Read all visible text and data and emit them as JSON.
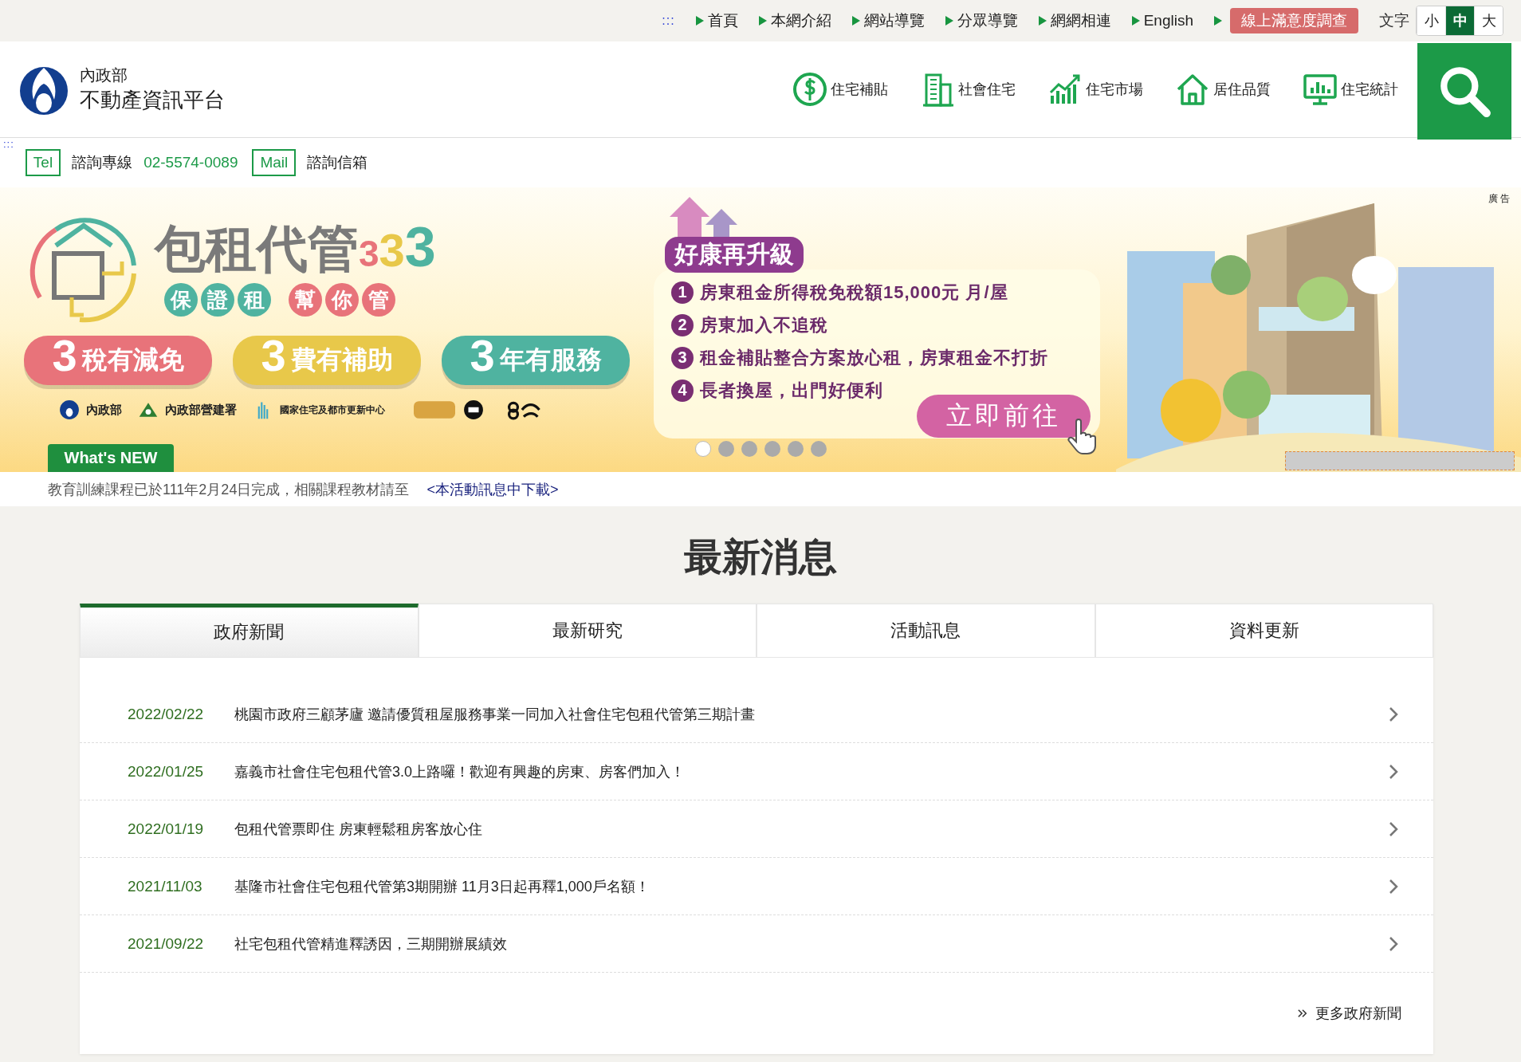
{
  "top_bar": {
    "access_key": ":::",
    "links": [
      {
        "label": "首頁"
      },
      {
        "label": "本網介紹"
      },
      {
        "label": "網站導覽"
      },
      {
        "label": "分眾導覽"
      },
      {
        "label": "網網相連"
      },
      {
        "label": "English"
      }
    ],
    "survey_button": "線上滿意度調查",
    "font_size": {
      "label": "文字",
      "options": [
        {
          "label": "小",
          "selected": false
        },
        {
          "label": "中",
          "selected": true
        },
        {
          "label": "大",
          "selected": false
        }
      ]
    }
  },
  "logo": {
    "org": "內政部",
    "name": "不動產資訊平台"
  },
  "main_nav": [
    {
      "label": "住宅補貼",
      "kind": "dollar"
    },
    {
      "label": "社會住宅",
      "kind": "building"
    },
    {
      "label": "住宅市場",
      "kind": "chart"
    },
    {
      "label": "居住品質",
      "kind": "house"
    },
    {
      "label": "住宅統計",
      "kind": "monitor"
    }
  ],
  "contact": {
    "access_key": ":::",
    "tel_badge": "Tel",
    "tel_label": "諮詢專線",
    "tel_number": "02-5574-0089",
    "mail_badge": "Mail",
    "mail_label": "諮詢信箱"
  },
  "banner": {
    "ad_label": "廣 告",
    "title": "包租代管",
    "title_digits": [
      {
        "text": "3",
        "color": "#e8737a"
      },
      {
        "text": "3",
        "color": "#e8c84a"
      },
      {
        "text": "3",
        "color": "#4fb3a0"
      }
    ],
    "taglines": [
      {
        "text": "保證租",
        "color": "#4fb3a0"
      },
      {
        "text": "幫你管",
        "color": "#e8737a"
      }
    ],
    "pills": [
      {
        "digit": "3",
        "text": "稅有減免",
        "color": "#e8737a"
      },
      {
        "digit": "3",
        "text": "費有補助",
        "color": "#e8c84a"
      },
      {
        "digit": "3",
        "text": "年有服務",
        "color": "#4fb3a0"
      }
    ],
    "partners": [
      "內政部",
      "內政部營建署",
      "國家住宅及都市更新中心"
    ],
    "promo_heading": "好康再升級",
    "promo_items": [
      {
        "num": "1",
        "text": "房東租金所得稅免稅額15,000元 月/屋"
      },
      {
        "num": "2",
        "text": "房東加入不追稅"
      },
      {
        "num": "3",
        "text": "租金補貼整合方案放心租，房東租金不打折"
      },
      {
        "num": "4",
        "text": "長者換屋，出門好便利"
      }
    ],
    "cta_button": "立即前往",
    "dots": [
      {
        "selected": true
      },
      {
        "selected": false
      },
      {
        "selected": false
      },
      {
        "selected": false
      },
      {
        "selected": false
      },
      {
        "selected": false
      }
    ]
  },
  "whats_new": {
    "tab": "What's NEW",
    "text": "教育訓練課程已於111年2月24日完成，相關課程教材請至",
    "link": "<本活動訊息中下載>"
  },
  "news": {
    "heading": "最新消息",
    "tabs": [
      {
        "label": "政府新聞",
        "selected": true
      },
      {
        "label": "最新研究",
        "selected": false
      },
      {
        "label": "活動訊息",
        "selected": false
      },
      {
        "label": "資料更新",
        "selected": false
      }
    ],
    "items": [
      {
        "date": "2022/02/22",
        "title": "桃園市政府三顧茅廬 邀請優質租屋服務事業一同加入社會住宅包租代管第三期計畫"
      },
      {
        "date": "2022/01/25",
        "title": "嘉義市社會住宅包租代管3.0上路囉！歡迎有興趣的房東、房客們加入！"
      },
      {
        "date": "2022/01/19",
        "title": "包租代管票即住 房東輕鬆租房客放心住"
      },
      {
        "date": "2021/11/03",
        "title": "基隆市社會住宅包租代管第3期開辦 11月3日起再釋1,000戶名額！"
      },
      {
        "date": "2021/09/22",
        "title": "社宅包租代管精進釋誘因，三期開辦展績效"
      }
    ],
    "more": "更多政府新聞"
  }
}
